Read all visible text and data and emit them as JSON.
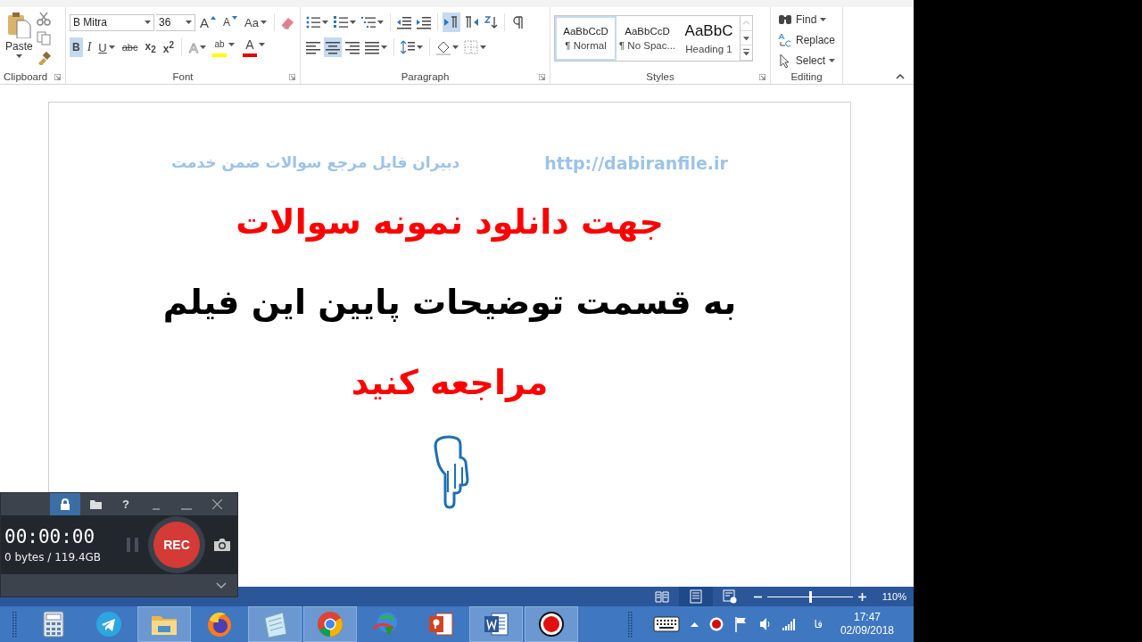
{
  "clipboard": {
    "paste_label": "Paste",
    "group_label": "Clipboard"
  },
  "font": {
    "name": "B Mitra",
    "size": "36",
    "group_label": "Font",
    "row1": [
      {
        "kind": "grow",
        "label": "A"
      },
      {
        "kind": "shrink",
        "label": "A"
      },
      {
        "kind": "case",
        "label": "Aa"
      }
    ],
    "row2": [
      {
        "kind": "bold",
        "label": "B",
        "selected": true
      },
      {
        "kind": "italic",
        "label": "I",
        "selected": false
      },
      {
        "kind": "underline",
        "label": "U",
        "selected": false
      },
      {
        "kind": "strike",
        "label": "abc",
        "selected": false
      },
      {
        "kind": "sub",
        "label": "x$_{2}$",
        "selected": false
      },
      {
        "kind": "super",
        "label": "x$^{2}$",
        "selected": false
      },
      {
        "kind": "effects",
        "label": "A",
        "selected": false
      },
      {
        "kind": "highlight",
        "label": "ab",
        "selected": false
      },
      {
        "kind": "color",
        "label": "A",
        "selected": false
      }
    ]
  },
  "paragraph": {
    "group_label": "Paragraph",
    "row1": [
      {
        "kind": "bullets",
        "selected": false
      },
      {
        "kind": "numbering",
        "selected": false
      },
      {
        "kind": "multilevel",
        "selected": false
      },
      {
        "kind": "outdent",
        "selected": false
      },
      {
        "kind": "indent",
        "selected": false
      },
      {
        "kind": "ltr",
        "selected": true
      },
      {
        "kind": "rtl",
        "selected": false
      },
      {
        "kind": "sort",
        "selected": false
      },
      {
        "kind": "pilcrow",
        "selected": false
      }
    ],
    "row2": [
      {
        "kind": "left",
        "selected": false
      },
      {
        "kind": "center",
        "selected": true
      },
      {
        "kind": "right",
        "selected": false
      },
      {
        "kind": "justify",
        "selected": false
      },
      {
        "kind": "spacing",
        "selected": false
      },
      {
        "kind": "shading",
        "selected": false
      },
      {
        "kind": "borders",
        "selected": false
      }
    ]
  },
  "styles": {
    "group_label": "Styles",
    "items": [
      {
        "kind": "normal",
        "sample": "AaBbCcD",
        "name": "¶ Normal",
        "selected": true
      },
      {
        "kind": "normal",
        "sample": "AaBbCcD",
        "name": "¶ No Spac...",
        "selected": false
      },
      {
        "kind": "heading",
        "sample": "AaBbC",
        "name": "Heading 1",
        "selected": false
      }
    ]
  },
  "editing": {
    "group_label": "Editing",
    "items": [
      {
        "kind": "find",
        "label": "Find"
      },
      {
        "kind": "replace",
        "label": "Replace"
      },
      {
        "kind": "select",
        "label": "Select"
      }
    ]
  },
  "document": {
    "header_left": "دبیران فایل مرجع سوالات ضمن خدمت",
    "header_right": "http://dabiranfile.ir",
    "lines": [
      {
        "text": "جهت دانلود نمونه سوالات",
        "color": "#ff0000"
      },
      {
        "text": "به قسمت توضیحات پایین این فیلم",
        "color": "#000000"
      },
      {
        "text": "مراجعه کنید",
        "color": "#ff0000"
      }
    ]
  },
  "status_bar": {
    "views": [
      {
        "kind": "read",
        "selected": false
      },
      {
        "kind": "print",
        "selected": true
      },
      {
        "kind": "web",
        "selected": false
      }
    ],
    "zoom": {
      "level": 0.5,
      "reading": "110%"
    }
  },
  "recorder": {
    "help": "?",
    "timer": "00:00:00",
    "size": "0 bytes / 119.4GB",
    "rec": "REC",
    "lock_selected": true
  },
  "taskbar": {
    "apps": [
      {
        "kind": "calculator",
        "open": false
      },
      {
        "kind": "telegram",
        "open": false
      },
      {
        "kind": "folder",
        "open": true
      },
      {
        "kind": "firefox",
        "open": false
      },
      {
        "kind": "notepad",
        "open": true
      },
      {
        "kind": "chrome",
        "open": true
      },
      {
        "kind": "downloader",
        "open": false
      },
      {
        "kind": "slides",
        "open": false
      },
      {
        "kind": "word",
        "open": true
      },
      {
        "kind": "recorder",
        "open": true
      }
    ],
    "language": "فا",
    "time": "17:47",
    "date": "02/09/2018"
  }
}
